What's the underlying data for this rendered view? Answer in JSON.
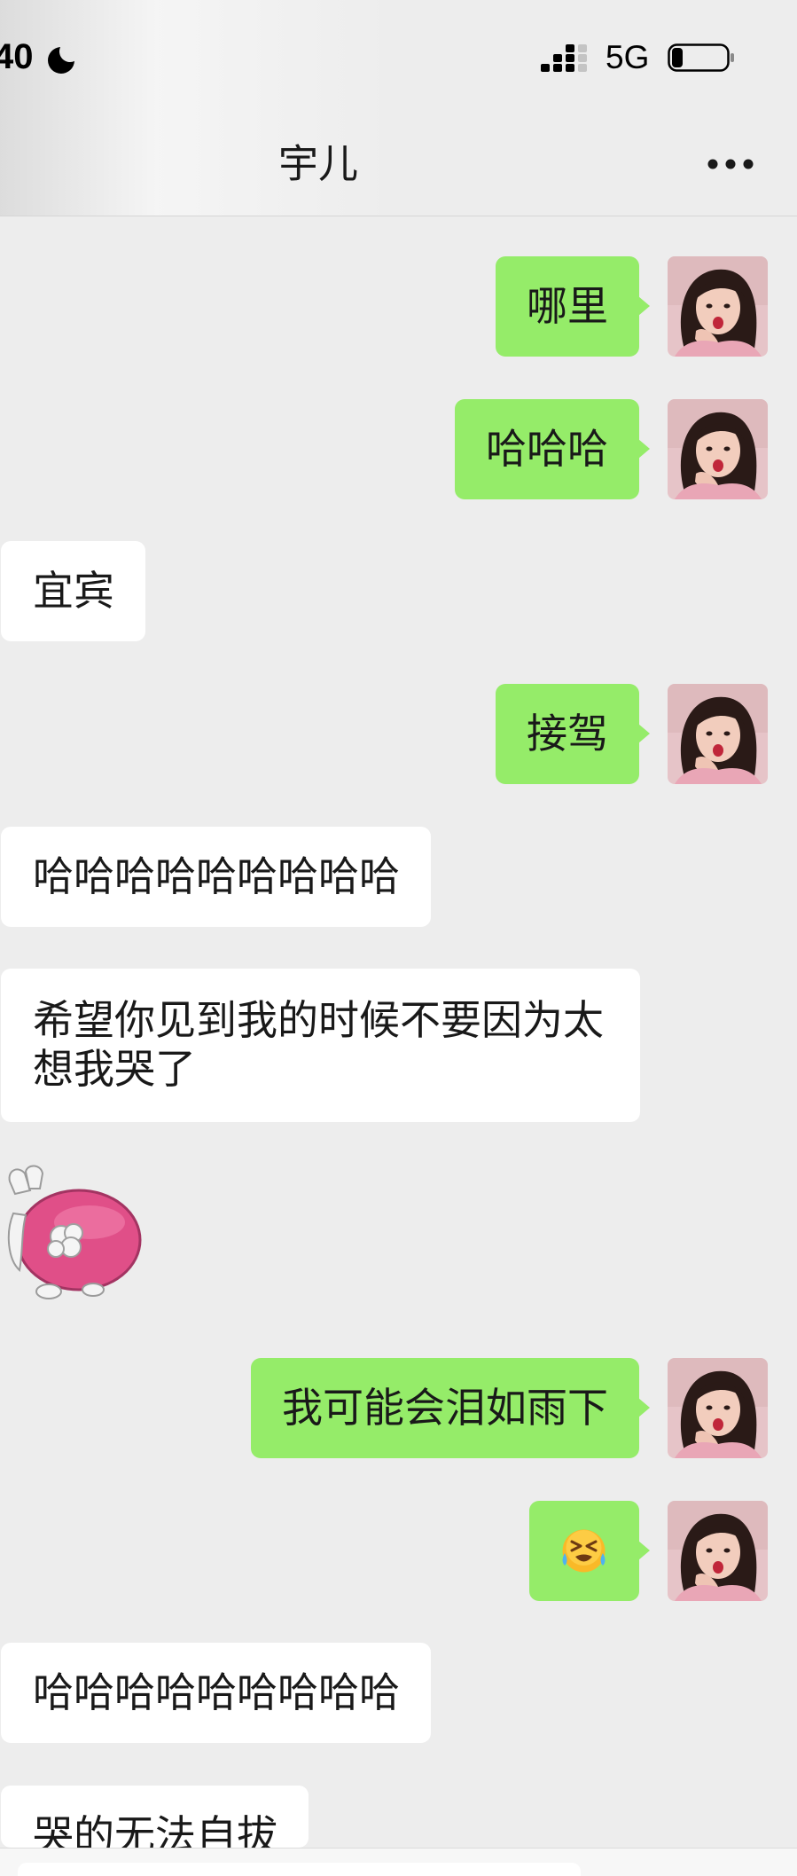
{
  "status_bar": {
    "time": "40",
    "network": "5G",
    "battery_level": 0.2,
    "moon_icon": "moon-icon",
    "signal_icon": "signal-icon",
    "battery_icon": "battery-icon"
  },
  "header": {
    "title": "宇儿",
    "more_icon": "more-icon"
  },
  "messages": [
    {
      "sent": true,
      "text": "哪里"
    },
    {
      "sent": true,
      "text": "哈哈哈"
    },
    {
      "sent": false,
      "text": "宜宾"
    },
    {
      "sent": true,
      "text": "接驾"
    },
    {
      "sent": false,
      "text": "哈哈哈哈哈哈哈哈哈"
    },
    {
      "sent": false,
      "text": "希望你见到我的时候不要因为太想我哭了"
    },
    {
      "sent": false,
      "sticker": "pink-pig-sticker"
    },
    {
      "sent": true,
      "text": "我可能会泪如雨下"
    },
    {
      "sent": true,
      "emoji": "cry-laugh-emoji"
    },
    {
      "sent": false,
      "text": "哈哈哈哈哈哈哈哈哈"
    },
    {
      "sent": false,
      "text": "哭的无法自拔"
    }
  ],
  "colors": {
    "background": "#ededed",
    "sent_bubble": "#95ec69",
    "received_bubble": "#ffffff",
    "text": "#191919"
  }
}
